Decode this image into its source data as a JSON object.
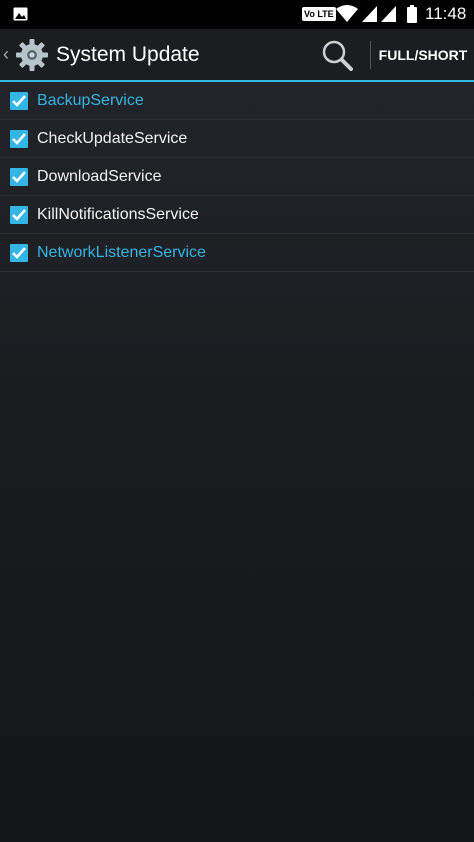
{
  "status_bar": {
    "volte_label": "Vo LTE",
    "time": "11:48"
  },
  "action_bar": {
    "back_glyph": "‹",
    "title": "System Update",
    "toggle_label": "FULL/SHORT"
  },
  "colors": {
    "accent": "#33b5e5",
    "background": "#1a1c20"
  },
  "services": [
    {
      "label": "BackupService",
      "checked": true,
      "highlight": true
    },
    {
      "label": "CheckUpdateService",
      "checked": true,
      "highlight": false
    },
    {
      "label": "DownloadService",
      "checked": true,
      "highlight": false
    },
    {
      "label": "KillNotificationsService",
      "checked": true,
      "highlight": false
    },
    {
      "label": "NetworkListenerService",
      "checked": true,
      "highlight": true
    }
  ]
}
